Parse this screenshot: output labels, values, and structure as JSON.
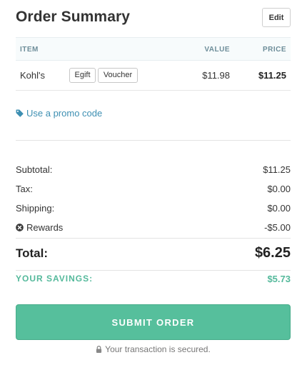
{
  "header": {
    "title": "Order Summary",
    "edit_label": "Edit"
  },
  "table": {
    "columns": {
      "item": "ITEM",
      "value": "VALUE",
      "price": "PRICE"
    },
    "rows": [
      {
        "name": "Kohl's",
        "tags": [
          "Egift",
          "Voucher"
        ],
        "value": "$11.98",
        "price": "$11.25"
      }
    ]
  },
  "promo": {
    "label": "Use a promo code",
    "icon": "tag-icon"
  },
  "summary": {
    "subtotal": {
      "label": "Subtotal:",
      "value": "$11.25"
    },
    "tax": {
      "label": "Tax:",
      "value": "$0.00"
    },
    "shipping": {
      "label": "Shipping:",
      "value": "$0.00"
    },
    "rewards": {
      "label": "Rewards",
      "value": "-$5.00",
      "icon": "remove-circle-icon"
    }
  },
  "total": {
    "label": "Total:",
    "value": "$6.25"
  },
  "savings": {
    "label": "YOUR SAVINGS:",
    "value": "$5.73"
  },
  "submit": {
    "label": "SUBMIT ORDER"
  },
  "secure": {
    "text": "Your transaction is secured.",
    "icon": "lock-icon"
  },
  "colors": {
    "accent": "#56bf9c",
    "link": "#3d8fb2",
    "savings": "#54b99b",
    "header_text": "#6d8d99"
  }
}
